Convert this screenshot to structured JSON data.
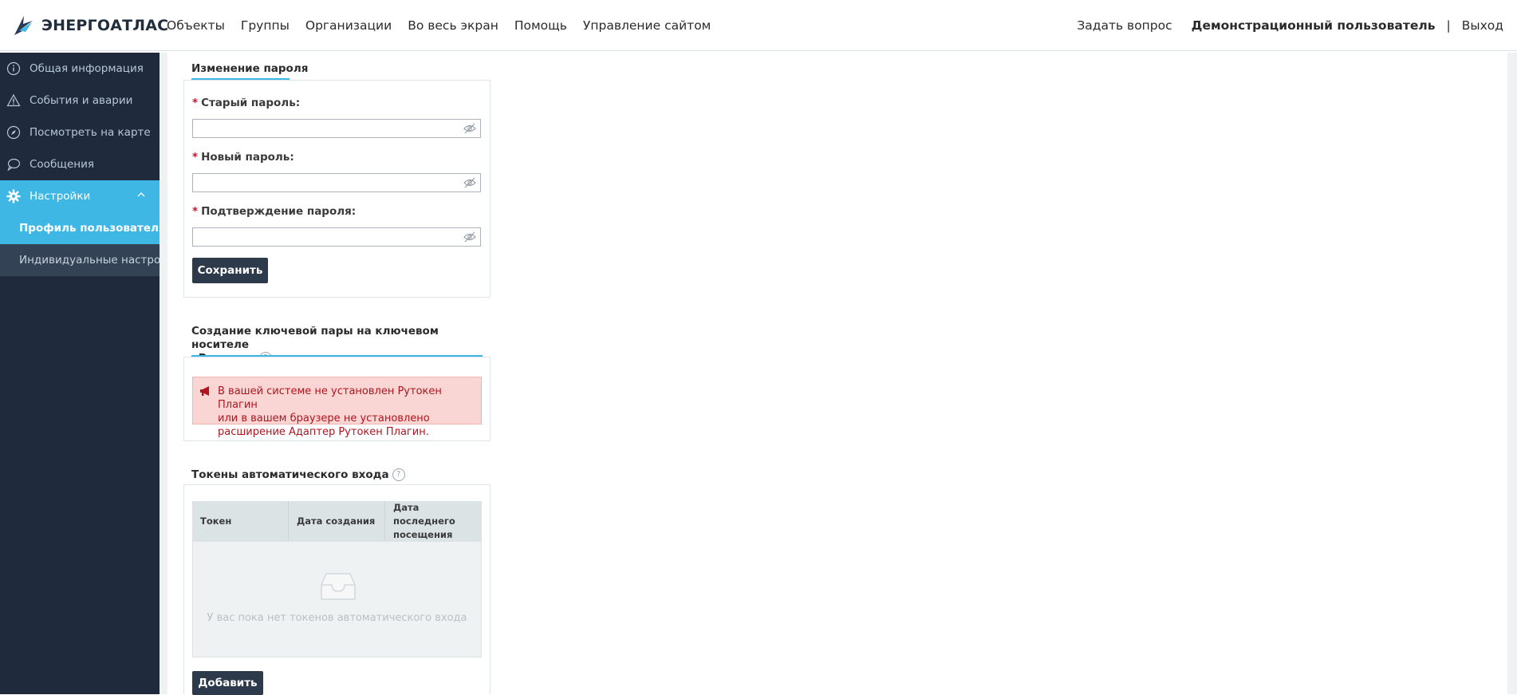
{
  "header": {
    "logo_text": "ЭНЕРГОАТЛАС",
    "nav": [
      "Объекты",
      "Группы",
      "Организации",
      "Во весь экран",
      "Помощь",
      "Управление сайтом"
    ],
    "ask_question": "Задать вопрос",
    "user_name": "Демонстрационный пользователь",
    "separator": "|",
    "logout": "Выход"
  },
  "sidebar": {
    "items": [
      {
        "label": "Общая информация",
        "icon": "info-icon"
      },
      {
        "label": "События и аварии",
        "icon": "warning-icon"
      },
      {
        "label": "Посмотреть на карте",
        "icon": "compass-icon"
      },
      {
        "label": "Сообщения",
        "icon": "chat-icon"
      },
      {
        "label": "Настройки",
        "icon": "gear-icon"
      }
    ],
    "subitems": [
      {
        "label": "Профиль пользователя"
      },
      {
        "label": "Индивидуальные настрой..."
      }
    ]
  },
  "password_section": {
    "title": "Изменение пароля",
    "old_password_label": "Старый пароль:",
    "new_password_label": "Новый пароль:",
    "confirm_password_label": "Подтверждение пароля:",
    "required_mark": "*",
    "save_button": "Сохранить"
  },
  "rutoken_section": {
    "title_line1": "Создание ключевой пары на ключевом носителе",
    "title_line2": "«Рутокен»",
    "help": "?",
    "alert_line1": "В вашей системе не установлен Рутокен Плагин",
    "alert_line2": "или в вашем браузере не установлено",
    "alert_line3": "расширение Адаптер Рутокен Плагин."
  },
  "tokens_section": {
    "title": "Токены автоматического входа",
    "help": "?",
    "columns": [
      "Токен",
      "Дата создания",
      "Дата последнего посещения"
    ],
    "empty_text": "У вас пока нет токенов автоматического входа",
    "add_button": "Добавить"
  },
  "colors": {
    "sidebar_bg": "#1f2a3c",
    "accent": "#3eb7e5",
    "button_bg": "#2c3a4c",
    "alert_bg": "#f9d6d4",
    "alert_text": "#b1141e"
  }
}
